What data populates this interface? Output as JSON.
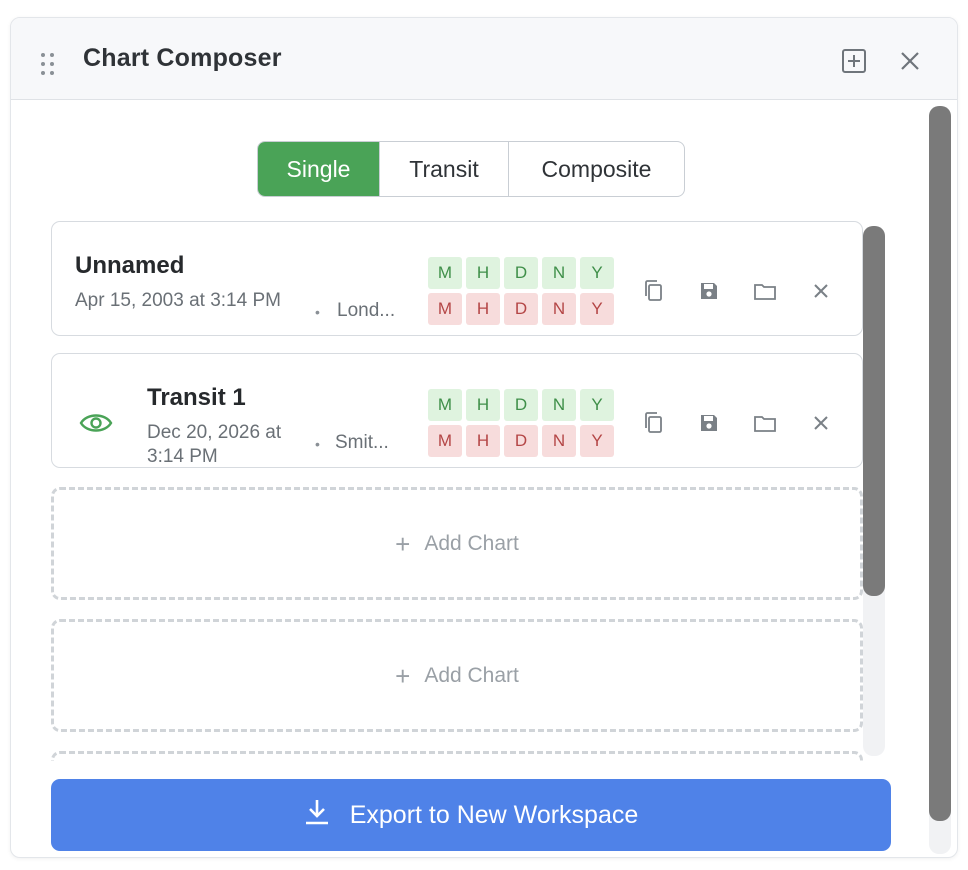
{
  "window": {
    "title": "Chart Composer",
    "icons": {
      "drag": "drag-handle-icon",
      "add": "add-square-icon",
      "close": "close-icon"
    }
  },
  "mode_tabs": [
    {
      "label": "Single",
      "active": true
    },
    {
      "label": "Transit",
      "active": false
    },
    {
      "label": "Composite",
      "active": false
    }
  ],
  "charts": [
    {
      "name": "Unnamed",
      "date": "Apr 15, 2003 at 3:14 PM",
      "location": "Lond...",
      "visible_icon": false,
      "badges_top": [
        "M",
        "H",
        "D",
        "N",
        "Y"
      ],
      "badges_bottom": [
        "M",
        "H",
        "D",
        "N",
        "Y"
      ]
    },
    {
      "name": "Transit 1",
      "date": "Dec 20, 2026 at 3:14 PM",
      "location": "Smit...",
      "visible_icon": true,
      "badges_top": [
        "M",
        "H",
        "D",
        "N",
        "Y"
      ],
      "badges_bottom": [
        "M",
        "H",
        "D",
        "N",
        "Y"
      ]
    }
  ],
  "add_slots": [
    {
      "label": "Add Chart"
    },
    {
      "label": "Add Chart"
    }
  ],
  "export": {
    "label": "Export to New Workspace",
    "icon": "download-icon"
  },
  "colors": {
    "accent_green": "#4aa357",
    "badge_green_bg": "#dff3df",
    "badge_red_bg": "#f7dcdc",
    "export_blue": "#4f82e8"
  }
}
